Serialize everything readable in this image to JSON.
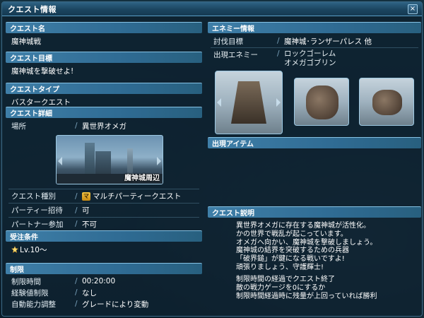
{
  "window": {
    "title": "クエスト情報",
    "close_label": "×"
  },
  "left": {
    "quest_name": {
      "header": "クエスト名",
      "value": "魔神城戦"
    },
    "quest_goal": {
      "header": "クエスト目標",
      "value": "魔神城を撃破せよ!"
    },
    "quest_type": {
      "header": "クエストタイプ",
      "value": "バスタークエスト"
    },
    "quest_detail": {
      "header": "クエスト詳細",
      "location_label": "場所",
      "location_value": "異世界オメガ",
      "area_caption": "魔神城周辺"
    },
    "quest_kind": {
      "label": "クエスト種別",
      "badge": "マ",
      "value": "マルチパーティークエスト"
    },
    "party_invite": {
      "label": "パーティー招待",
      "value": "可"
    },
    "partner_join": {
      "label": "パートナー参加",
      "value": "不可"
    },
    "order_conditions": {
      "header": "受注条件",
      "level": "Lv.10〜"
    },
    "limits": {
      "header": "制限",
      "rows": [
        {
          "label": "制限時間",
          "value": "00:20:00"
        },
        {
          "label": "経験値制限",
          "value": "なし"
        },
        {
          "label": "自動能力調整",
          "value": "グレードにより変動"
        }
      ]
    }
  },
  "right": {
    "enemy_info": {
      "header": "エネミー情報",
      "target_label": "討伐目標",
      "target_value": "魔神城･ランザーパレス 他",
      "appear_label": "出現エネミー",
      "appear_values": [
        "ロックゴーレム",
        "オメガゴブリン"
      ]
    },
    "items": {
      "header": "出現アイテム"
    },
    "description": {
      "header": "クエスト説明",
      "lines": [
        "異世界オメガに存在する魔神城が活性化。",
        "かの世界で戦乱が起こっています。",
        "オメガへ向かい、魔神城を撃破しましょう。",
        "魔神城の結界を突破するための兵器",
        "「破界鎚」が鍵になる戦いですよ!",
        "頑張りましょう、守護輝士!"
      ],
      "conditions": [
        "制限時間の経過でクエスト終了",
        "敵の戦力ゲージを0にするか",
        "制限時間経過時に残量が上回っていれば勝利"
      ]
    }
  }
}
